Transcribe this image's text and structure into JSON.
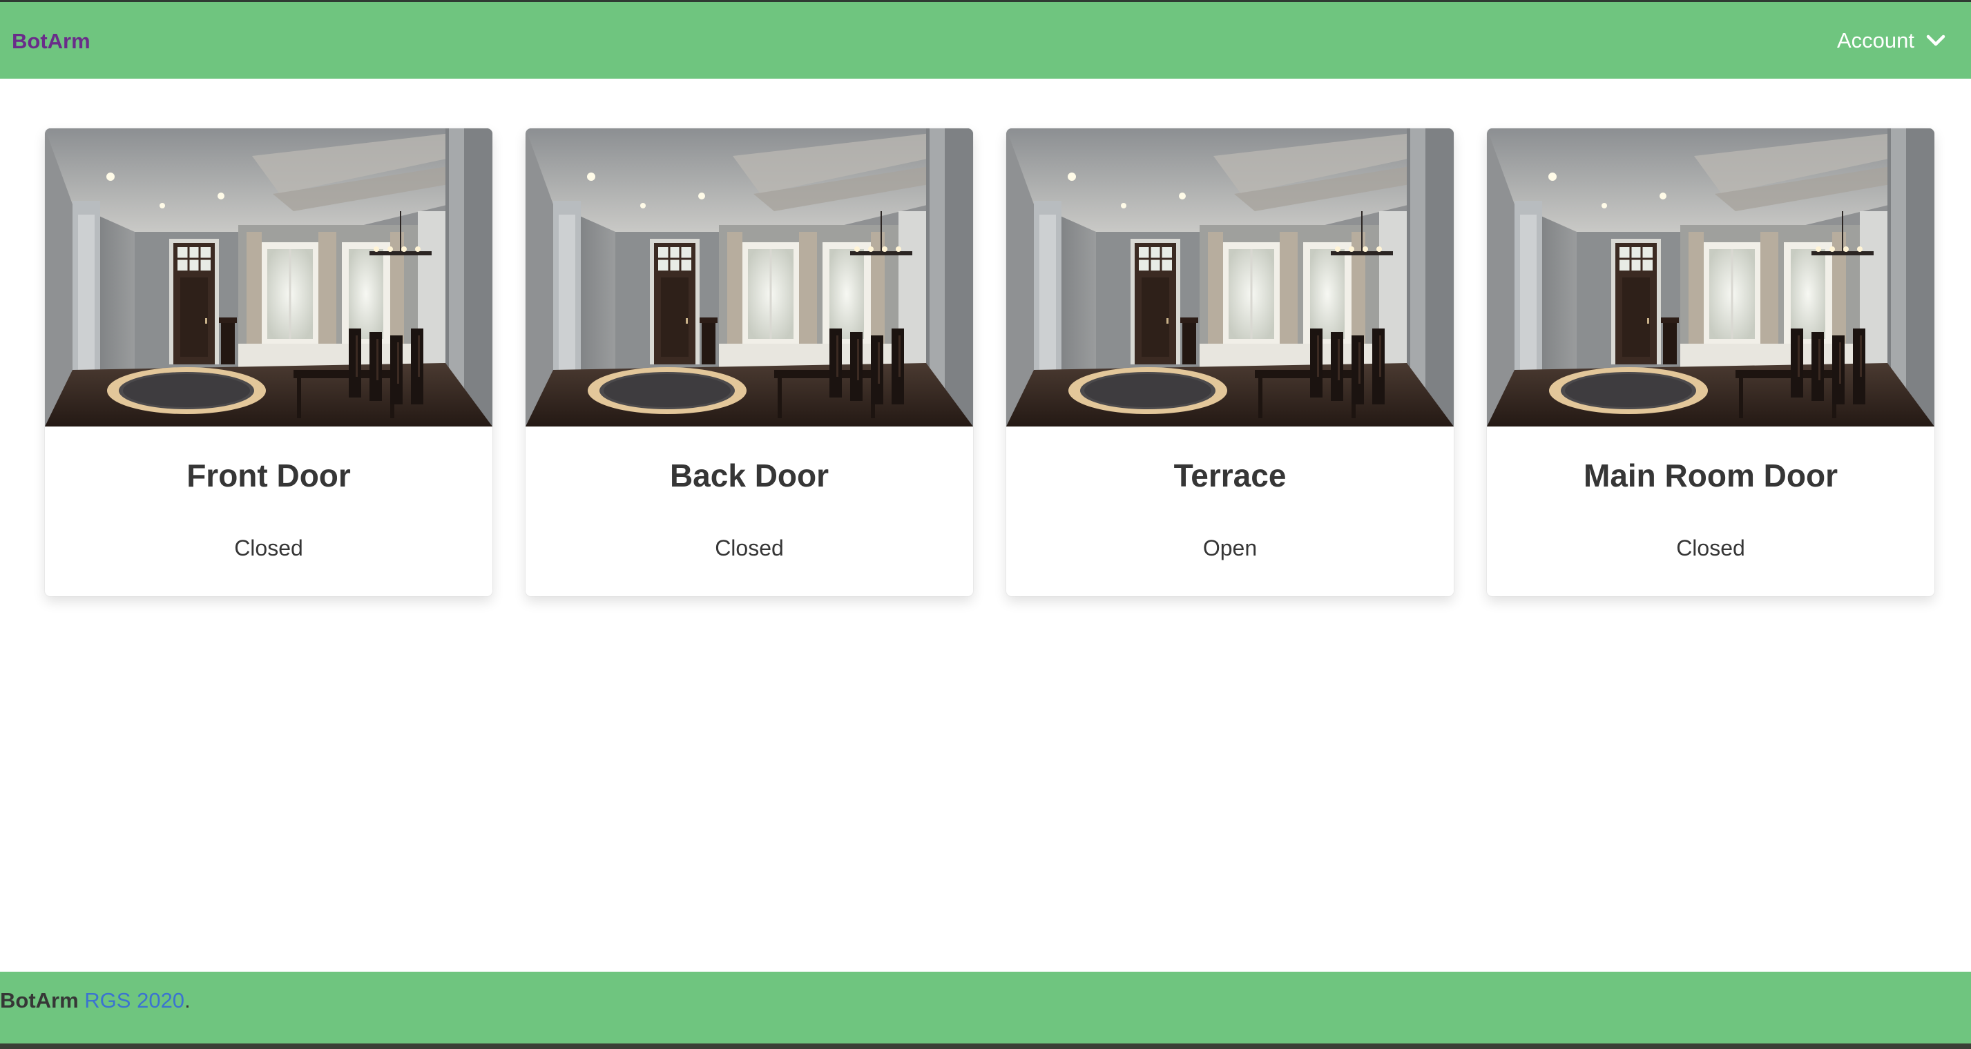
{
  "navbar": {
    "brand": "BotArm",
    "account_label": "Account"
  },
  "doors": [
    {
      "name": "Front Door",
      "status": "Closed"
    },
    {
      "name": "Back Door",
      "status": "Closed"
    },
    {
      "name": "Terrace",
      "status": "Open"
    },
    {
      "name": "Main Room Door",
      "status": "Closed"
    }
  ],
  "footer": {
    "brand": "BotArm",
    "link_text": "RGS 2020",
    "suffix": "."
  },
  "colors": {
    "navbar_bg": "#6fc57f",
    "brand": "#6a2c8a",
    "link": "#3b73d1"
  }
}
